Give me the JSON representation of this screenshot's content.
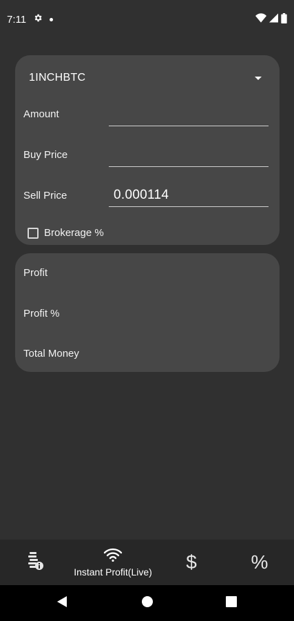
{
  "status_bar": {
    "time": "7:11",
    "icons": [
      "gear-icon",
      "notification-dot-icon",
      "wifi-icon",
      "cellular-signal-icon",
      "battery-icon"
    ]
  },
  "calculator": {
    "pair": {
      "selected": "1INCHBTC",
      "icon": "chevron-down-icon"
    },
    "fields": {
      "amount": {
        "label": "Amount",
        "value": ""
      },
      "buy_price": {
        "label": "Buy Price",
        "value": ""
      },
      "sell_price": {
        "label": "Sell Price",
        "value": "0.000114"
      }
    },
    "brokerage": {
      "label": "Brokerage %",
      "checked": false
    }
  },
  "results": {
    "profit_label": "Profit",
    "profit_percent_label": "Profit %",
    "total_money_label": "Total Money"
  },
  "bottom_nav": {
    "items": [
      {
        "name": "coin-info-icon",
        "label": ""
      },
      {
        "name": "wifi-icon",
        "label": "Instant Profit(Live)"
      },
      {
        "name": "dollar-icon",
        "label": "",
        "glyph": "$"
      },
      {
        "name": "percent-icon",
        "label": "",
        "glyph": "%"
      }
    ]
  },
  "system_nav": [
    "back-icon",
    "home-icon",
    "recents-icon"
  ],
  "colors": {
    "background": "#303030",
    "card": "#474747",
    "nav": "#272727"
  }
}
